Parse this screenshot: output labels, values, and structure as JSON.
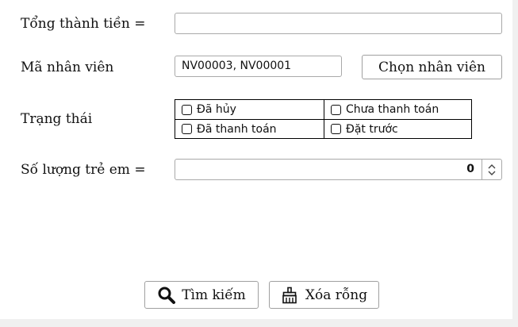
{
  "form": {
    "total_label": "Tổng thành tiền =",
    "total_value": "",
    "employee_label": "Mã nhân viên",
    "employee_value": "NV00003, NV00001",
    "choose_employee_button": "Chọn nhân viên",
    "status_label": "Trạng thái",
    "status_options": [
      {
        "label": "Đã hủy",
        "checked": false
      },
      {
        "label": "Chưa thanh toán",
        "checked": false
      },
      {
        "label": "Đã thanh toán",
        "checked": false
      },
      {
        "label": "Đặt trước",
        "checked": false
      }
    ],
    "children_label": "Số lượng trẻ em =",
    "children_value": "0"
  },
  "actions": {
    "search_button": "Tìm kiếm",
    "clear_button": "Xóa rỗng"
  },
  "icons": {
    "search": "search-icon",
    "clear": "broom-icon",
    "spinner": "spinner-arrows-icon"
  }
}
